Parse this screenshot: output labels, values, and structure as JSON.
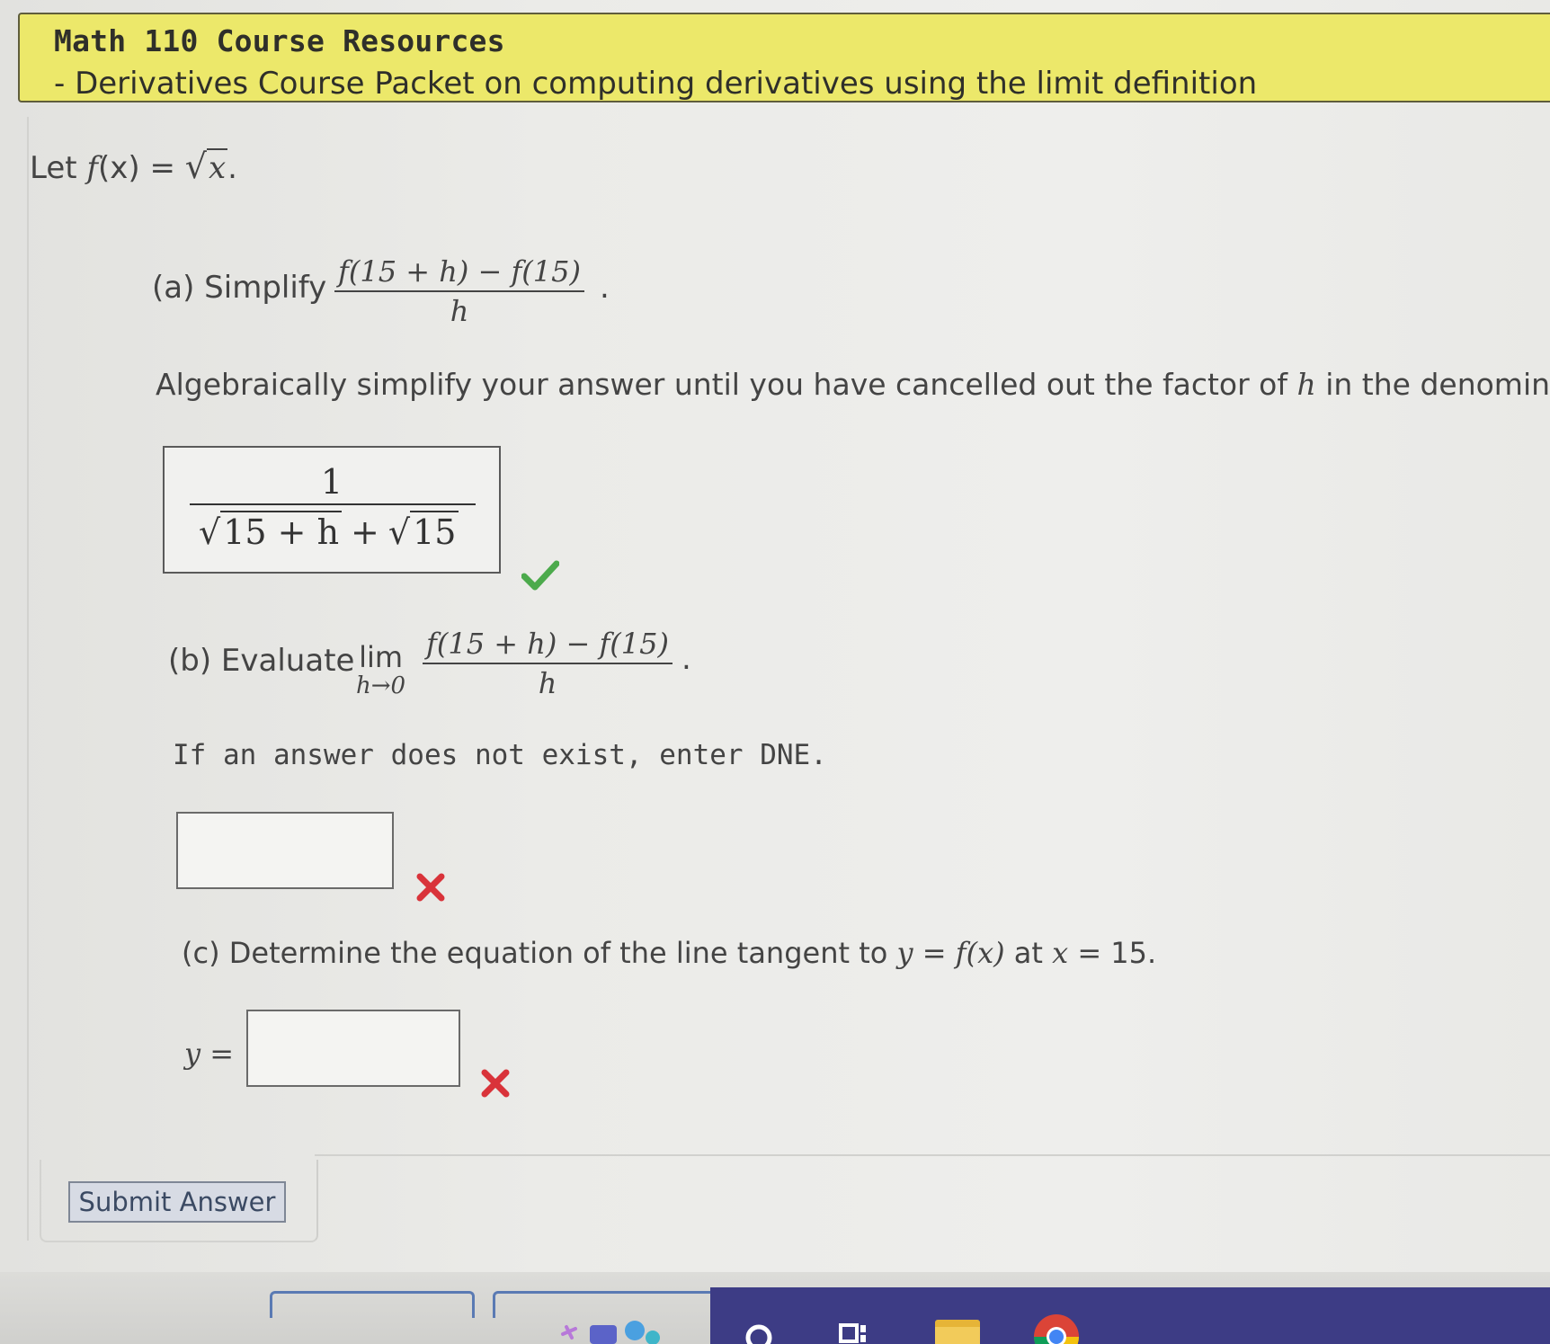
{
  "header": {
    "title": "Math 110 Course Resources",
    "subtitle": "- Derivatives Course Packet on computing derivatives using the limit definition"
  },
  "intro": {
    "let": "Let ",
    "f": "f",
    "x_paren": "(x) = ",
    "radicand": "x",
    "period": "."
  },
  "part_a": {
    "label": "(a) Simplify",
    "numerator": "f(15 + h) − f(15)",
    "denominator": "h",
    "period": ".",
    "instruction_pre": "Algebraically simplify your answer until you have cancelled out the factor of ",
    "instruction_var": "h",
    "instruction_post": " in the denominator.",
    "answer_numerator": "1",
    "answer_radicand_1": "15 + h",
    "answer_plus": "+",
    "answer_radicand_2": "15",
    "status": "correct"
  },
  "part_b": {
    "label": "(b) Evaluate",
    "lim": "lim",
    "lim_sub": "h→0",
    "numerator": "f(15 + h) − f(15)",
    "denominator": "h",
    "period": ".",
    "instruction": "If an answer does not exist, enter DNE.",
    "input_value": "",
    "status": "incorrect"
  },
  "part_c": {
    "label_pre": "(c) Determine the equation of the line tangent to ",
    "eq_y": "y",
    "eq_mid": " = ",
    "eq_f": "f",
    "eq_x": "(x)",
    "label_at": " at ",
    "at_x": "x",
    "label_post": " = 15.",
    "y_label": "y =",
    "input_value": "",
    "status": "incorrect"
  },
  "submit": {
    "label": "Submit Answer"
  },
  "colors": {
    "banner": "#ece86a",
    "correct": "#4caa4c",
    "incorrect": "#d9333a",
    "taskbar_dark": "#3d3c85"
  },
  "icons": [
    "check-icon",
    "cross-icon",
    "search-icon",
    "taskview-icon",
    "file-explorer-icon",
    "chrome-icon",
    "widgets-icon"
  ]
}
